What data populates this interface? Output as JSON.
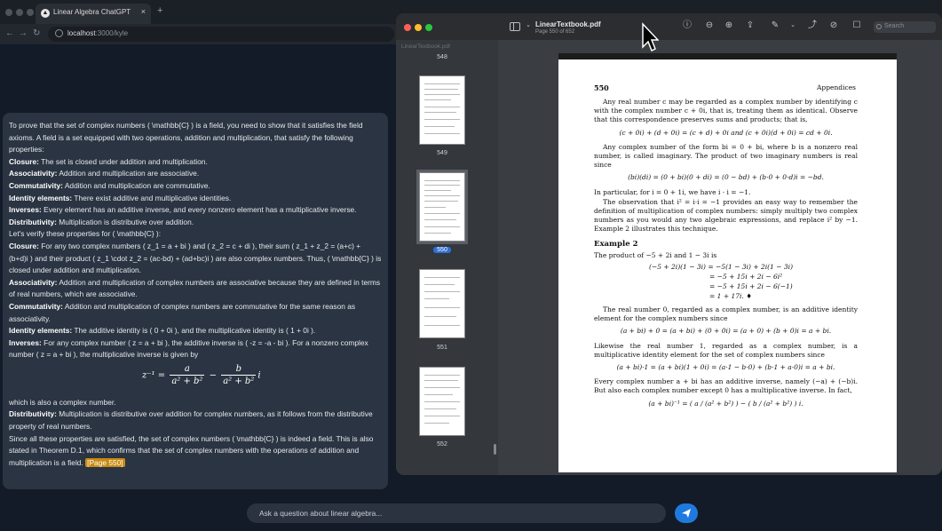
{
  "browser": {
    "tab_title": "Linear Algebra ChatGPT",
    "tab_close": "×",
    "new_tab": "+",
    "back": "←",
    "forward": "→",
    "reload": "↻",
    "url_host": "localhost",
    "url_path": ":3000/kyle"
  },
  "chat": {
    "intro1": "To prove that the set of complex numbers ( \\mathbb{C} ) is a field, you need to show that it satisfies the field axioms. A field is a set equipped with two operations, addition and multiplication, that satisfy the following properties:",
    "axioms": [
      {
        "term": "Closure:",
        "text": " The set is closed under addition and multiplication."
      },
      {
        "term": "Associativity:",
        "text": " Addition and multiplication are associative."
      },
      {
        "term": "Commutativity:",
        "text": " Addition and multiplication are commutative."
      },
      {
        "term": "Identity elements:",
        "text": " There exist additive and multiplicative identities."
      },
      {
        "term": "Inverses:",
        "text": " Every element has an additive inverse, and every nonzero element has a multiplicative inverse."
      },
      {
        "term": "Distributivity:",
        "text": " Multiplication is distributive over addition."
      }
    ],
    "verify_intro": "Let's verify these properties for ( \\mathbb{C} ):",
    "checks": [
      {
        "term": "Closure:",
        "text": " For any two complex numbers ( z_1 = a + bi ) and ( z_2 = c + di ), their sum ( z_1 + z_2 = (a+c) + (b+d)i ) and their product ( z_1 \\cdot z_2 = (ac-bd) + (ad+bc)i ) are also complex numbers. Thus, ( \\mathbb{C} ) is closed under addition and multiplication."
      },
      {
        "term": "Associativity:",
        "text": " Addition and multiplication of complex numbers are associative because they are defined in terms of real numbers, which are associative."
      },
      {
        "term": "Commutativity:",
        "text": " Addition and multiplication of complex numbers are commutative for the same reason as associativity."
      },
      {
        "term": "Identity elements:",
        "text": " The additive identity is ( 0 + 0i ), and the multiplicative identity is ( 1 + 0i )."
      },
      {
        "term": "Inverses:",
        "text": " For any complex number ( z = a + bi ), the additive inverse is ( -z = -a - bi ). For a nonzero complex number ( z = a + bi ), the multiplicative inverse is given by"
      }
    ],
    "formula": {
      "lhs": "z⁻¹ =",
      "num1": "a",
      "den1": "a² + b²",
      "minus": "−",
      "num2": "b",
      "den2": "a² + b²",
      "tail": "i"
    },
    "after_formula": "which is also a complex number.",
    "dist_term": "Distributivity:",
    "dist_text": " Multiplication is distributive over addition for complex numbers, as it follows from the distributive property of real numbers.",
    "conclusion": "Since all these properties are satisfied, the set of complex numbers ( \\mathbb{C} ) is indeed a field. This is also stated in Theorem D.1, which confirms that the set of complex numbers with the operations of addition and multiplication is a field.",
    "citation": "[Page 550]",
    "input_placeholder": "Ask a question about linear algebra..."
  },
  "pdf": {
    "doc_title": "LinearTextbook.pdf",
    "doc_subtitle": "Page 550 of 652",
    "sidebar_filename": "LinearTextbook.pdf",
    "search_placeholder": "Search",
    "thumb_labels": [
      "548",
      "549",
      "550",
      "551",
      "552"
    ],
    "page": {
      "number": "550",
      "header": "Appendices",
      "p1": "Any real number c may be regarded as a complex number by identifying c with the complex number c + 0i, that is, treating them as identical. Observe that this correspondence preserves sums and products; that is,",
      "eq1": "(c + 0i) + (d + 0i) = (c + d) + 0i    and    (c + 0i)(d + 0i) = cd + 0i.",
      "p2": "Any complex number of the form bi = 0 + bi, where b is a nonzero real number, is called imaginary. The product of two imaginary numbers is real since",
      "eq2": "(bi)(di) = (0 + bi)(0 + di) = (0 − bd) + (b·0 + 0·d)i = −bd.",
      "p3": "In particular, for i = 0 + 1i, we have i · i = −1.",
      "p4": "The observation that i² = i·i = −1 provides an easy way to remember the definition of multiplication of complex numbers: simply multiply two complex numbers as you would any two algebraic expressions, and replace i² by −1. Example 2 illustrates this technique.",
      "example_title": "Example 2",
      "example_intro": "The product of −5 + 2i and 1 − 3i is",
      "align": [
        "(−5 + 2i)(1 − 3i) = −5(1 − 3i) + 2i(1 − 3i)",
        "= −5 + 15i + 2i − 6i²",
        "= −5 + 15i + 2i − 6(−1)",
        "= 1 + 17i.   ♦"
      ],
      "p5": "The real number 0, regarded as a complex number, is an additive identity element for the complex numbers since",
      "eq3": "(a + bi) + 0 = (a + bi) + (0 + 0i) = (a + 0) + (b + 0)i = a + bi.",
      "p6": "Likewise the real number 1, regarded as a complex number, is a multiplicative identity element for the set of complex numbers since",
      "eq4": "(a + bi)·1 = (a + bi)(1 + 0i) = (a·1 − b·0) + (b·1 + a·0)i = a + bi.",
      "p7": "Every complex number a + bi has an additive inverse, namely (−a) + (−b)i. But also each complex number except 0 has a multiplicative inverse. In fact,",
      "eq5": "(a + bi)⁻¹ = ( a / (a² + b²) ) − ( b / (a² + b²) ) i."
    }
  },
  "colors": {
    "chat_bg": "#121b27",
    "bubble": "#2a3442",
    "citation": "#c98a12",
    "send": "#1f7ae0",
    "pdf_window": "#3a3d42"
  }
}
